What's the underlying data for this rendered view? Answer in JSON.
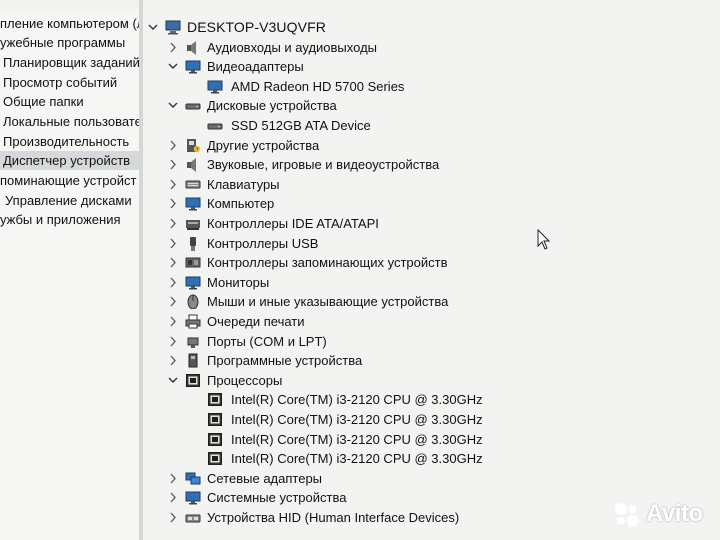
{
  "left_pane": {
    "items": [
      {
        "label": "пление компьютером (л"
      },
      {
        "label": "ужебные программы"
      },
      {
        "label": "Планировщик заданий"
      },
      {
        "label": "Просмотр событий"
      },
      {
        "label": "Общие папки"
      },
      {
        "label": "Локальные пользовате"
      },
      {
        "label": "Производительность"
      },
      {
        "label": "Диспетчер устройств"
      },
      {
        "label": "поминающие устройст"
      },
      {
        "label": "Управление дисками"
      },
      {
        "label": "ужбы и приложения"
      }
    ],
    "selected_index": 7
  },
  "tree": {
    "root": {
      "label": "DESKTOP-V3UQVFR",
      "icon": "computer-icon"
    },
    "rows": [
      {
        "label": "Аудиовходы и аудиовыходы",
        "icon": "speaker-icon",
        "chevron": "collapsed",
        "indent": 1
      },
      {
        "label": "Видеоадаптеры",
        "icon": "monitor-icon",
        "chevron": "expanded",
        "indent": 1
      },
      {
        "label": "AMD Radeon HD 5700 Series",
        "icon": "display-adapter-icon",
        "chevron": "none",
        "indent": 2
      },
      {
        "label": "Дисковые устройства",
        "icon": "disk-drive-icon",
        "chevron": "expanded",
        "indent": 1
      },
      {
        "label": "SSD 512GB ATA Device",
        "icon": "disk-drive-icon",
        "chevron": "none",
        "indent": 2
      },
      {
        "label": "Другие устройства",
        "icon": "unknown-device-icon",
        "chevron": "collapsed",
        "indent": 1
      },
      {
        "label": "Звуковые, игровые и видеоустройства",
        "icon": "speaker-icon",
        "chevron": "collapsed",
        "indent": 1
      },
      {
        "label": "Клавиатуры",
        "icon": "keyboard-icon",
        "chevron": "collapsed",
        "indent": 1
      },
      {
        "label": "Компьютер",
        "icon": "monitor-icon",
        "chevron": "collapsed",
        "indent": 1
      },
      {
        "label": "Контроллеры IDE ATA/ATAPI",
        "icon": "ide-controller-icon",
        "chevron": "collapsed",
        "indent": 1
      },
      {
        "label": "Контроллеры USB",
        "icon": "usb-icon",
        "chevron": "collapsed",
        "indent": 1
      },
      {
        "label": "Контроллеры запоминающих устройств",
        "icon": "storage-controller-icon",
        "chevron": "collapsed",
        "indent": 1
      },
      {
        "label": "Мониторы",
        "icon": "monitor-icon",
        "chevron": "collapsed",
        "indent": 1
      },
      {
        "label": "Мыши и иные указывающие устройства",
        "icon": "mouse-icon",
        "chevron": "collapsed",
        "indent": 1
      },
      {
        "label": "Очереди печати",
        "icon": "printer-icon",
        "chevron": "collapsed",
        "indent": 1
      },
      {
        "label": "Порты (COM и LPT)",
        "icon": "port-icon",
        "chevron": "collapsed",
        "indent": 1
      },
      {
        "label": "Программные устройства",
        "icon": "software-device-icon",
        "chevron": "collapsed",
        "indent": 1
      },
      {
        "label": "Процессоры",
        "icon": "processor-icon",
        "chevron": "expanded",
        "indent": 1
      },
      {
        "label": "Intel(R) Core(TM) i3-2120 CPU @ 3.30GHz",
        "icon": "processor-icon",
        "chevron": "none",
        "indent": 2
      },
      {
        "label": "Intel(R) Core(TM) i3-2120 CPU @ 3.30GHz",
        "icon": "processor-icon",
        "chevron": "none",
        "indent": 2
      },
      {
        "label": "Intel(R) Core(TM) i3-2120 CPU @ 3.30GHz",
        "icon": "processor-icon",
        "chevron": "none",
        "indent": 2
      },
      {
        "label": "Intel(R) Core(TM) i3-2120 CPU @ 3.30GHz",
        "icon": "processor-icon",
        "chevron": "none",
        "indent": 2
      },
      {
        "label": "Сетевые адаптеры",
        "icon": "network-adapter-icon",
        "chevron": "collapsed",
        "indent": 1
      },
      {
        "label": "Системные устройства",
        "icon": "system-device-icon",
        "chevron": "collapsed",
        "indent": 1
      },
      {
        "label": "Устройства HID (Human Interface Devices)",
        "icon": "hid-icon",
        "chevron": "collapsed",
        "indent": 1
      }
    ]
  },
  "watermark": {
    "text": "Avito"
  },
  "colors": {
    "background": "#f3f4f2",
    "selected": "#d6d9dc",
    "icon_blue": "#2f6fb3"
  }
}
